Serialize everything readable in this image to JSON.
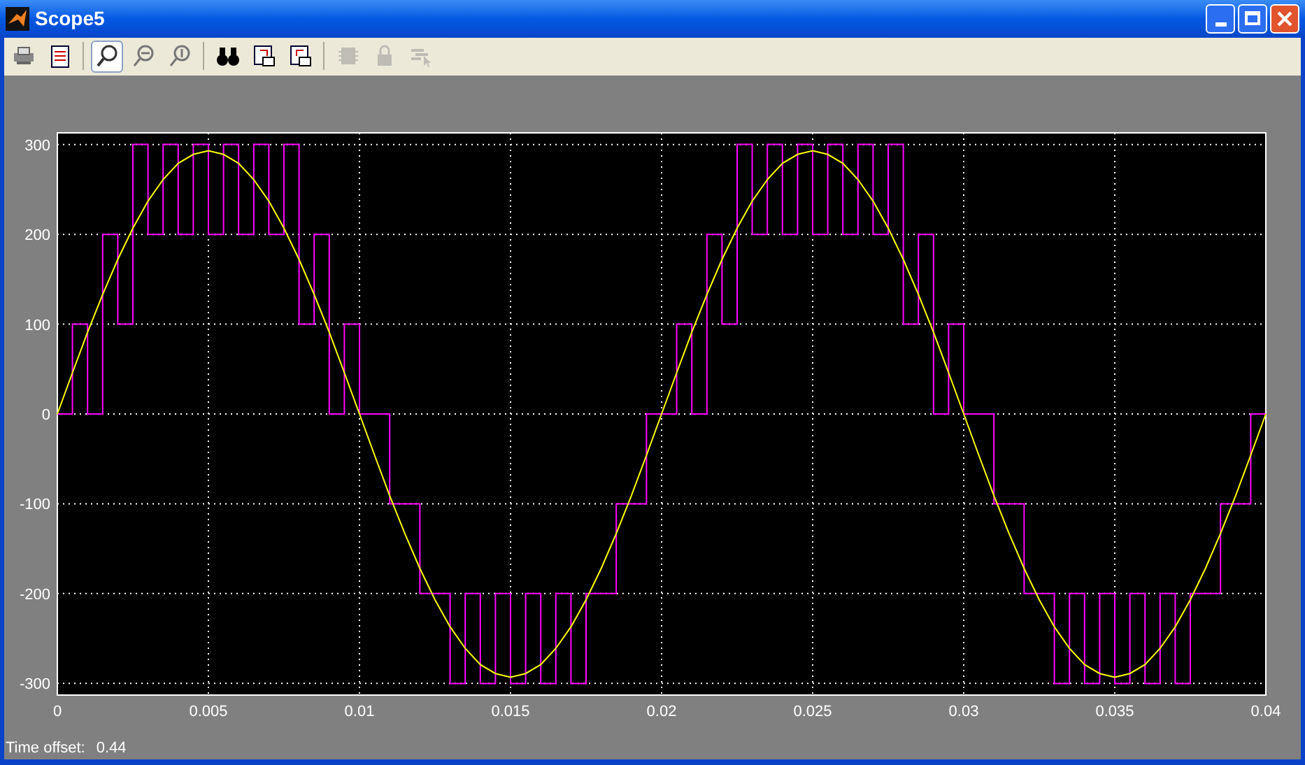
{
  "window": {
    "title": "Scope5"
  },
  "toolbar": [
    {
      "selected": false,
      "disabled": false
    },
    {
      "selected": false,
      "disabled": false
    },
    {
      "selected": true,
      "disabled": false
    },
    {
      "selected": false,
      "disabled": false
    },
    {
      "selected": false,
      "disabled": false
    },
    {
      "selected": false,
      "disabled": false
    },
    {
      "selected": false,
      "disabled": false
    },
    {
      "selected": false,
      "disabled": false
    },
    {
      "selected": false,
      "disabled": true
    },
    {
      "selected": false,
      "disabled": true
    },
    {
      "selected": false,
      "disabled": true
    }
  ],
  "chart_data": {
    "type": "line",
    "grid": true,
    "xlim": [
      0,
      0.04
    ],
    "ylim": [
      -313,
      313
    ],
    "xticks": [
      {
        "value": 0,
        "label": "0"
      },
      {
        "value": 0.005,
        "label": "0.005"
      },
      {
        "value": 0.01,
        "label": "0.01"
      },
      {
        "value": 0.015,
        "label": "0.015"
      },
      {
        "value": 0.02,
        "label": "0.02"
      },
      {
        "value": 0.025,
        "label": "0.025"
      },
      {
        "value": 0.03,
        "label": "0.03"
      },
      {
        "value": 0.035,
        "label": "0.035"
      },
      {
        "value": 0.04,
        "label": "0.04"
      }
    ],
    "yticks": [
      {
        "value": 300,
        "label": "300"
      },
      {
        "value": 200,
        "label": "200"
      },
      {
        "value": 100,
        "label": "100"
      },
      {
        "value": 0,
        "label": "0"
      },
      {
        "value": -100,
        "label": "-100"
      },
      {
        "value": -200,
        "label": "-200"
      },
      {
        "value": -300,
        "label": "-300"
      }
    ],
    "x": [
      0,
      0.0005,
      0.0005,
      0.001,
      0.001,
      0.0015,
      0.0015,
      0.002,
      0.002,
      0.0025,
      0.0025,
      0.003,
      0.003,
      0.0035,
      0.0035,
      0.004,
      0.004,
      0.0045,
      0.0045,
      0.005,
      0.005,
      0.0055,
      0.0055,
      0.006,
      0.006,
      0.0065,
      0.0065,
      0.007,
      0.007,
      0.0075,
      0.0075,
      0.008,
      0.008,
      0.0085,
      0.0085,
      0.009,
      0.009,
      0.0095,
      0.0095,
      0.01,
      0.01,
      0.0105,
      0.0105,
      0.011,
      0.011,
      0.0115,
      0.0115,
      0.012,
      0.012,
      0.0125,
      0.0125,
      0.013,
      0.013,
      0.0135,
      0.0135,
      0.014,
      0.014,
      0.0145,
      0.0145,
      0.015,
      0.015,
      0.0155,
      0.0155,
      0.016,
      0.016,
      0.0165,
      0.0165,
      0.017,
      0.017,
      0.0175,
      0.0175,
      0.018,
      0.018,
      0.0185,
      0.0185,
      0.019,
      0.019,
      0.0195,
      0.0195,
      0.02,
      0.02,
      0.0205,
      0.0205,
      0.021,
      0.021,
      0.0215,
      0.0215,
      0.022,
      0.022,
      0.0225,
      0.0225,
      0.023,
      0.023,
      0.0235,
      0.0235,
      0.024,
      0.024,
      0.0245,
      0.0245,
      0.025,
      0.025,
      0.0255,
      0.0255,
      0.026,
      0.026,
      0.0265,
      0.0265,
      0.027,
      0.027,
      0.0275,
      0.0275,
      0.028,
      0.028,
      0.0285,
      0.0285,
      0.029,
      0.029,
      0.0295,
      0.0295,
      0.03,
      0.03,
      0.0305,
      0.0305,
      0.031,
      0.031,
      0.0315,
      0.0315,
      0.032,
      0.032,
      0.0325,
      0.0325,
      0.033,
      0.033,
      0.0335,
      0.0335,
      0.034,
      0.034,
      0.0345,
      0.0345,
      0.035,
      0.035,
      0.0355,
      0.0355,
      0.036,
      0.036,
      0.0365,
      0.0365,
      0.037,
      0.037,
      0.0375,
      0.0375,
      0.038,
      0.038,
      0.0385,
      0.0385,
      0.039,
      0.039,
      0.0395,
      0.0395,
      0.04,
      0.04
    ],
    "series": [
      {
        "color": "#ff00ff",
        "values": [
          0,
          0,
          100,
          100,
          0,
          0,
          200,
          200,
          100,
          100,
          300,
          300,
          200,
          200,
          300,
          300,
          200,
          200,
          300,
          300,
          200,
          200,
          300,
          300,
          200,
          200,
          300,
          300,
          200,
          200,
          300,
          300,
          100,
          100,
          200,
          200,
          0,
          0,
          100,
          100,
          0,
          0,
          0,
          0,
          -100,
          -100,
          -100,
          -100,
          -200,
          -200,
          -200,
          -200,
          -300,
          -300,
          -200,
          -200,
          -300,
          -300,
          -200,
          -200,
          -300,
          -300,
          -200,
          -200,
          -300,
          -300,
          -200,
          -200,
          -300,
          -300,
          -200,
          -200,
          -200,
          -200,
          -100,
          -100,
          -100,
          -100,
          0,
          0,
          0,
          0,
          100,
          100,
          0,
          0,
          200,
          200,
          100,
          100,
          300,
          300,
          200,
          200,
          300,
          300,
          200,
          200,
          300,
          300,
          200,
          200,
          300,
          300,
          200,
          200,
          300,
          300,
          200,
          200,
          300,
          300,
          100,
          100,
          200,
          200,
          0,
          0,
          100,
          100,
          0,
          0,
          0,
          0,
          -100,
          -100,
          -100,
          -100,
          -200,
          -200,
          -200,
          -200,
          -300,
          -300,
          -200,
          -200,
          -300,
          -300,
          -200,
          -200,
          -300,
          -300,
          -200,
          -200,
          -300,
          -300,
          -200,
          -200,
          -300,
          -300,
          -200,
          -200,
          -200,
          -200,
          -100,
          -100,
          -100,
          -100,
          0,
          0,
          0
        ]
      },
      {
        "color": "#ffff00",
        "values": [
          0,
          46,
          46,
          91,
          91,
          133,
          133,
          172,
          172,
          207,
          207,
          237,
          237,
          261,
          261,
          279,
          279,
          289,
          289,
          293,
          293,
          289,
          289,
          279,
          279,
          261,
          261,
          237,
          237,
          207,
          207,
          172,
          172,
          133,
          133,
          91,
          91,
          46,
          46,
          0,
          0,
          -46,
          -46,
          -91,
          -91,
          -133,
          -133,
          -172,
          -172,
          -207,
          -207,
          -237,
          -237,
          -261,
          -261,
          -279,
          -279,
          -289,
          -289,
          -293,
          -293,
          -289,
          -289,
          -279,
          -279,
          -261,
          -261,
          -237,
          -237,
          -207,
          -207,
          -172,
          -172,
          -133,
          -133,
          -91,
          -91,
          -46,
          -46,
          0,
          0,
          46,
          46,
          91,
          91,
          133,
          133,
          172,
          172,
          207,
          207,
          237,
          237,
          261,
          261,
          279,
          279,
          289,
          289,
          293,
          293,
          289,
          289,
          279,
          279,
          261,
          261,
          237,
          237,
          207,
          207,
          172,
          172,
          133,
          133,
          91,
          91,
          46,
          46,
          0,
          0,
          -46,
          -46,
          -91,
          -91,
          -133,
          -133,
          -172,
          -172,
          -207,
          -207,
          -237,
          -237,
          -261,
          -261,
          -279,
          -279,
          -289,
          -289,
          -293,
          -293,
          -289,
          -289,
          -279,
          -279,
          -261,
          -261,
          -237,
          -237,
          -207,
          -207,
          -172,
          -172,
          -133,
          -133,
          -91,
          -91,
          -46,
          -46,
          0,
          0
        ]
      }
    ]
  },
  "status": {
    "label": "Time offset:",
    "value": "0.44"
  }
}
